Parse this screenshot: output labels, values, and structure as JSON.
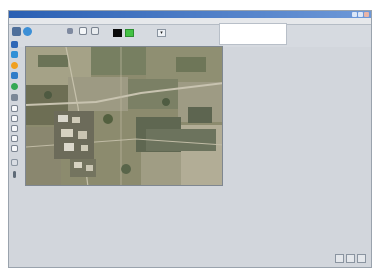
{
  "window": {
    "title": ""
  },
  "menu": {
    "items": []
  },
  "toolbar": {
    "zoom_label": "",
    "colors": {
      "black": "#0b0b0b",
      "green": "#43c244"
    }
  },
  "map": {
    "layer": "satellite-aerial-image"
  },
  "status": {
    "buttons": [
      "",
      "",
      ""
    ]
  }
}
